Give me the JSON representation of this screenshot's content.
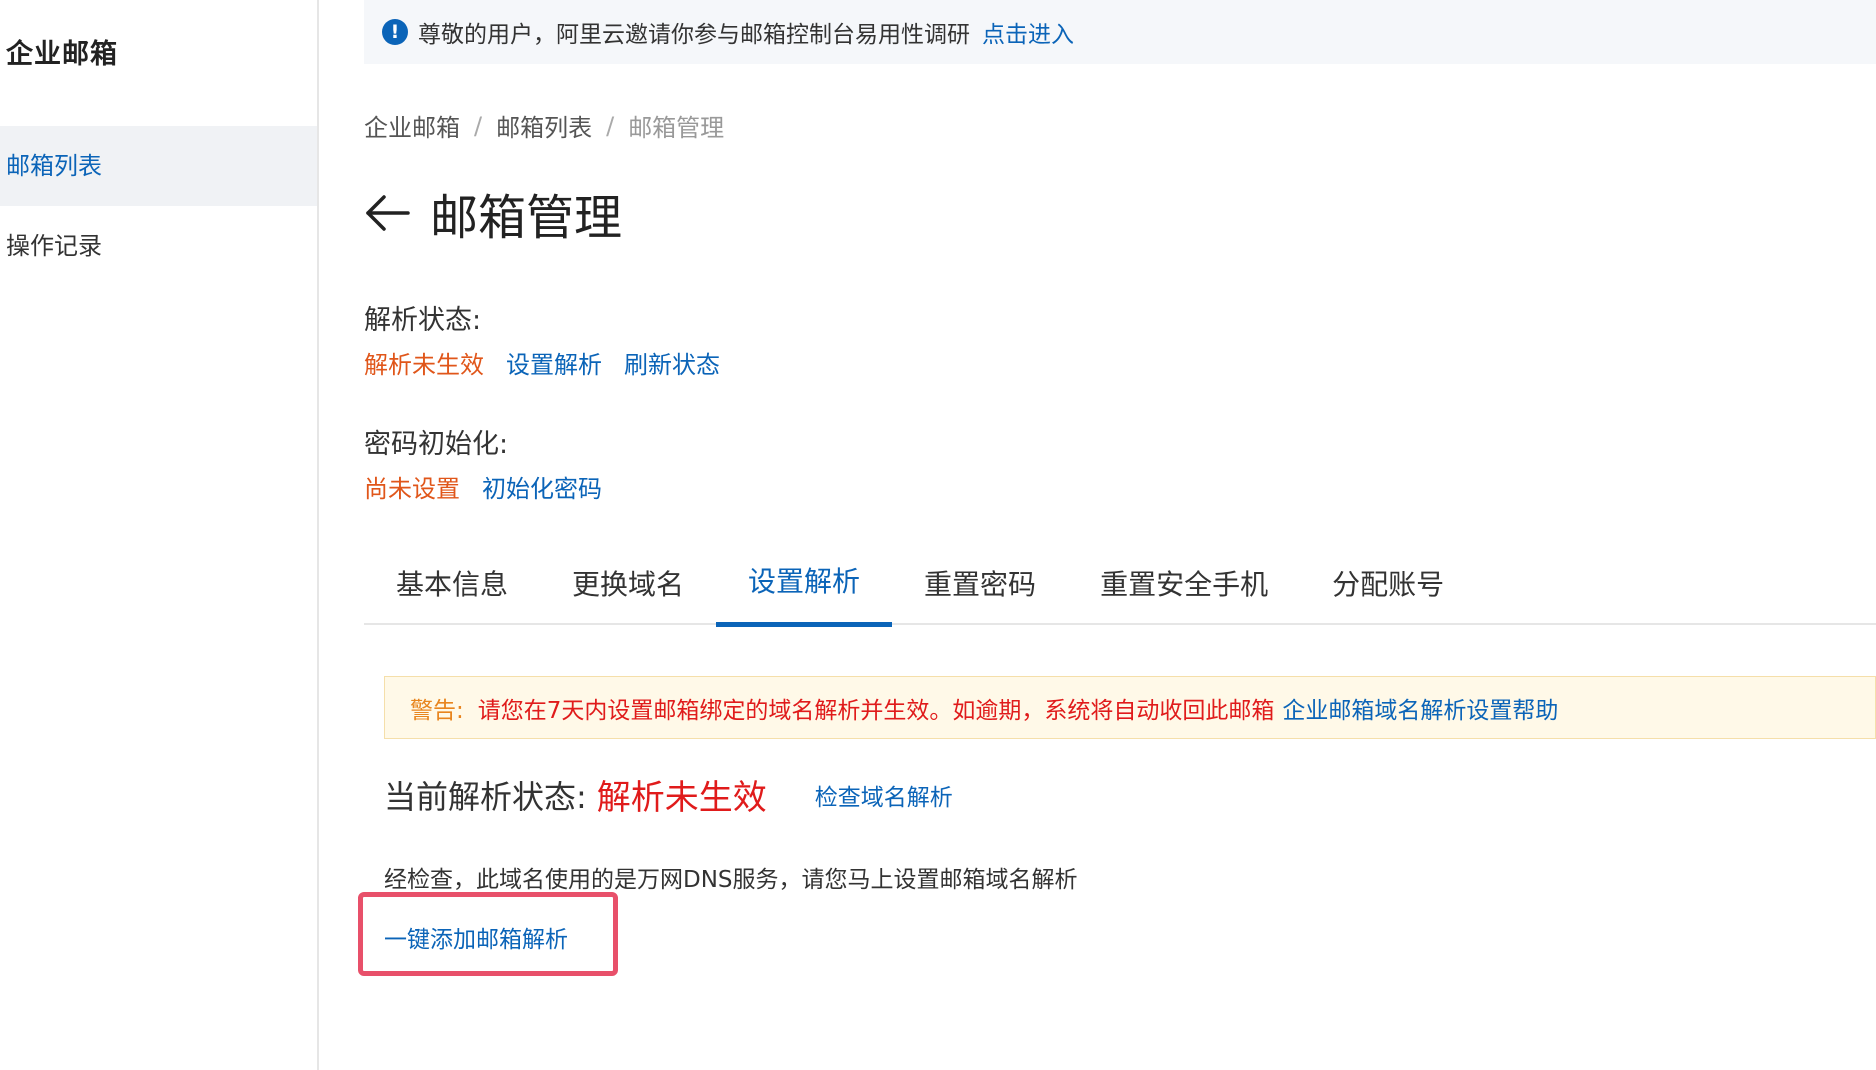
{
  "sidebar": {
    "title": "企业邮箱",
    "items": [
      {
        "label": "邮箱列表",
        "active": true
      },
      {
        "label": "操作记录",
        "active": false
      }
    ]
  },
  "notice": {
    "icon": "info-icon",
    "text": "尊敬的用户，阿里云邀请你参与邮箱控制台易用性调研",
    "link": "点击进入"
  },
  "breadcrumb": [
    "企业邮箱",
    "邮箱列表",
    "邮箱管理"
  ],
  "page": {
    "back_icon": "arrow-left-icon",
    "title": "邮箱管理"
  },
  "resolve": {
    "label": "解析状态:",
    "status": "解析未生效",
    "setup_link": "设置解析",
    "refresh_link": "刷新状态"
  },
  "password": {
    "label": "密码初始化:",
    "status": "尚未设置",
    "init_link": "初始化密码"
  },
  "tabs": [
    {
      "label": "基本信息",
      "active": false
    },
    {
      "label": "更换域名",
      "active": false
    },
    {
      "label": "设置解析",
      "active": true
    },
    {
      "label": "重置密码",
      "active": false
    },
    {
      "label": "重置安全手机",
      "active": false
    },
    {
      "label": "分配账号",
      "active": false
    }
  ],
  "warning": {
    "label": "警告:",
    "text": "请您在7天内设置邮箱绑定的域名解析并生效。如逾期，系统将自动收回此邮箱",
    "help_link": "企业邮箱域名解析设置帮助"
  },
  "current_status": {
    "label": "当前解析状态:",
    "value": "解析未生效",
    "check_link": "检查域名解析"
  },
  "check_message": "经检查，此域名使用的是万网DNS服务，请您马上设置邮箱域名解析",
  "one_click_link": "一键添加邮箱解析",
  "colors": {
    "link": "#0b64b8",
    "warning_text": "#e01b1b",
    "status_orange": "#e0561a",
    "highlight_border": "#e8506a"
  }
}
